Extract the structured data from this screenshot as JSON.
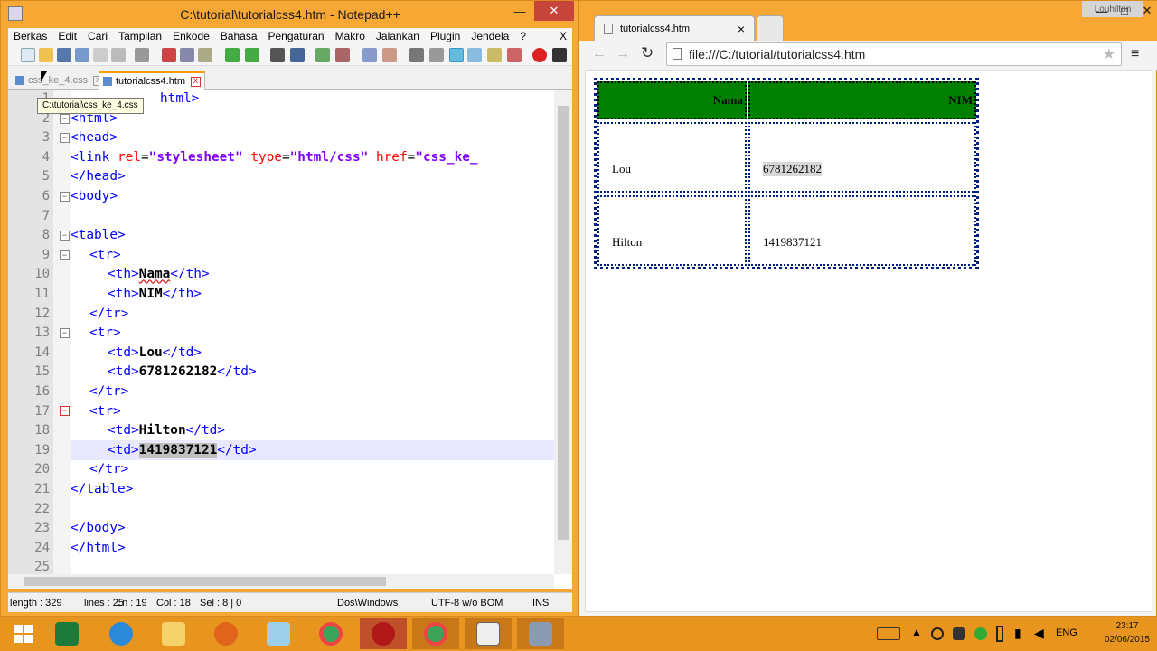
{
  "npp": {
    "title": "C:\\tutorial\\tutorialcss4.htm - Notepad++",
    "menu": [
      "Berkas",
      "Edit",
      "Cari",
      "Tampilan",
      "Enkode",
      "Bahasa",
      "Pengaturan",
      "Makro",
      "Jalankan",
      "Plugin",
      "Jendela",
      "?"
    ],
    "menu_close": "X",
    "tabs": [
      {
        "label": "css_ke_4.css"
      },
      {
        "label": "tutorialcss4.htm"
      }
    ],
    "tooltip": "C:\\tutorial\\css_ke_4.css",
    "lines": [
      "1",
      "2",
      "3",
      "4",
      "5",
      "6",
      "7",
      "8",
      "9",
      "10",
      "11",
      "12",
      "13",
      "14",
      "15",
      "16",
      "17",
      "18",
      "19",
      "20",
      "21",
      "22",
      "23",
      "24",
      "25"
    ],
    "status": {
      "length": "length : 329",
      "lines": "lines : 25",
      "ln": "Ln : 19",
      "col": "Col : 18",
      "sel": "Sel : 8 | 0",
      "eol": "Dos\\Windows",
      "encoding": "UTF-8 w/o BOM",
      "mode": "INS"
    },
    "code": {
      "l1": "html>",
      "l2": "<html>",
      "l3": "<head>",
      "l4_tag": "<link",
      "l4_a1": "rel",
      "l4_v1": "\"stylesheet\"",
      "l4_a2": "type",
      "l4_v2": "\"html/css\"",
      "l4_a3": "href",
      "l4_v3": "\"css_ke_",
      "l5": "</head>",
      "l6": "<body>",
      "l8": "<table>",
      "l9": "<tr>",
      "l10_o": "<th>",
      "l10_t": "Nama",
      "l10_c": "</th>",
      "l11_o": "<th>",
      "l11_t": "NIM",
      "l11_c": "</th>",
      "l12": "</tr>",
      "l13": "<tr>",
      "l14_o": "<td>",
      "l14_t": "Lou",
      "l14_c": "</td>",
      "l15_o": "<td>",
      "l15_t": "6781262182",
      "l15_c": "</td>",
      "l16": "</tr>",
      "l17": "<tr>",
      "l18_o": "<td>",
      "l18_t": "Hilton",
      "l18_c": "</td>",
      "l19_o": "<td>",
      "l19_t": "1419837121",
      "l19_c": "</td>",
      "l20": "</tr>",
      "l21": "</table>",
      "l23": "</body>",
      "l24": "</html>"
    }
  },
  "chrome": {
    "user": "Louhilton",
    "tab_label": "tutorialcss4.htm",
    "tab_close": "×",
    "url": "file:///C:/tutorial/tutorialcss4.htm",
    "table": {
      "headers": [
        "Nama",
        "NIM"
      ],
      "rows": [
        [
          "Lou",
          "6781262182"
        ],
        [
          "Hilton",
          "1419837121"
        ]
      ]
    }
  },
  "taskbar": {
    "lang": "ENG",
    "time": "23:17",
    "date": "02/06/2015"
  },
  "colors": {
    "th_bg": "#008000",
    "accent": "#f7a733"
  }
}
